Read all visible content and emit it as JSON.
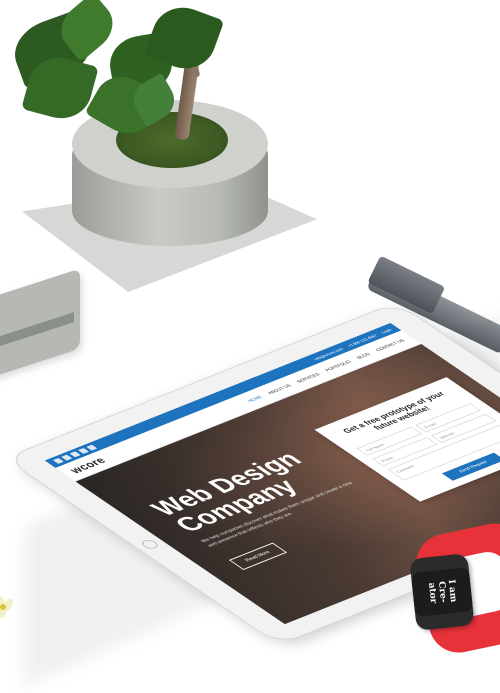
{
  "scene": {
    "tablet_website": {
      "top_icons": [
        "facebook-icon",
        "twitter-icon",
        "google-icon",
        "linkedin-icon",
        "youtube-icon"
      ],
      "top_info": [
        "info@wcore.com",
        "+1 800 123 4567",
        "Login"
      ],
      "logo": "wcore",
      "nav_items": [
        "Home",
        "About us",
        "Services",
        "Portfolio",
        "Blog",
        "Contact us"
      ],
      "hero_title": "Web Design Company",
      "hero_subtitle": "We help companies discover what makes them unique and create a new web presence that reflects who they are.",
      "hero_button": "Read More",
      "form_title": "Get a free prototype of your future website!",
      "form_fields": [
        "Full Name",
        "E-mail",
        "Phone",
        "Website"
      ],
      "form_message": "Comment",
      "form_button": "Send Request"
    },
    "watch_text": "I am\nCre-\nator",
    "colors": {
      "accent": "#1e73be",
      "watch_band": "#e8323a",
      "plant_leaf": "#2f5f22"
    }
  }
}
